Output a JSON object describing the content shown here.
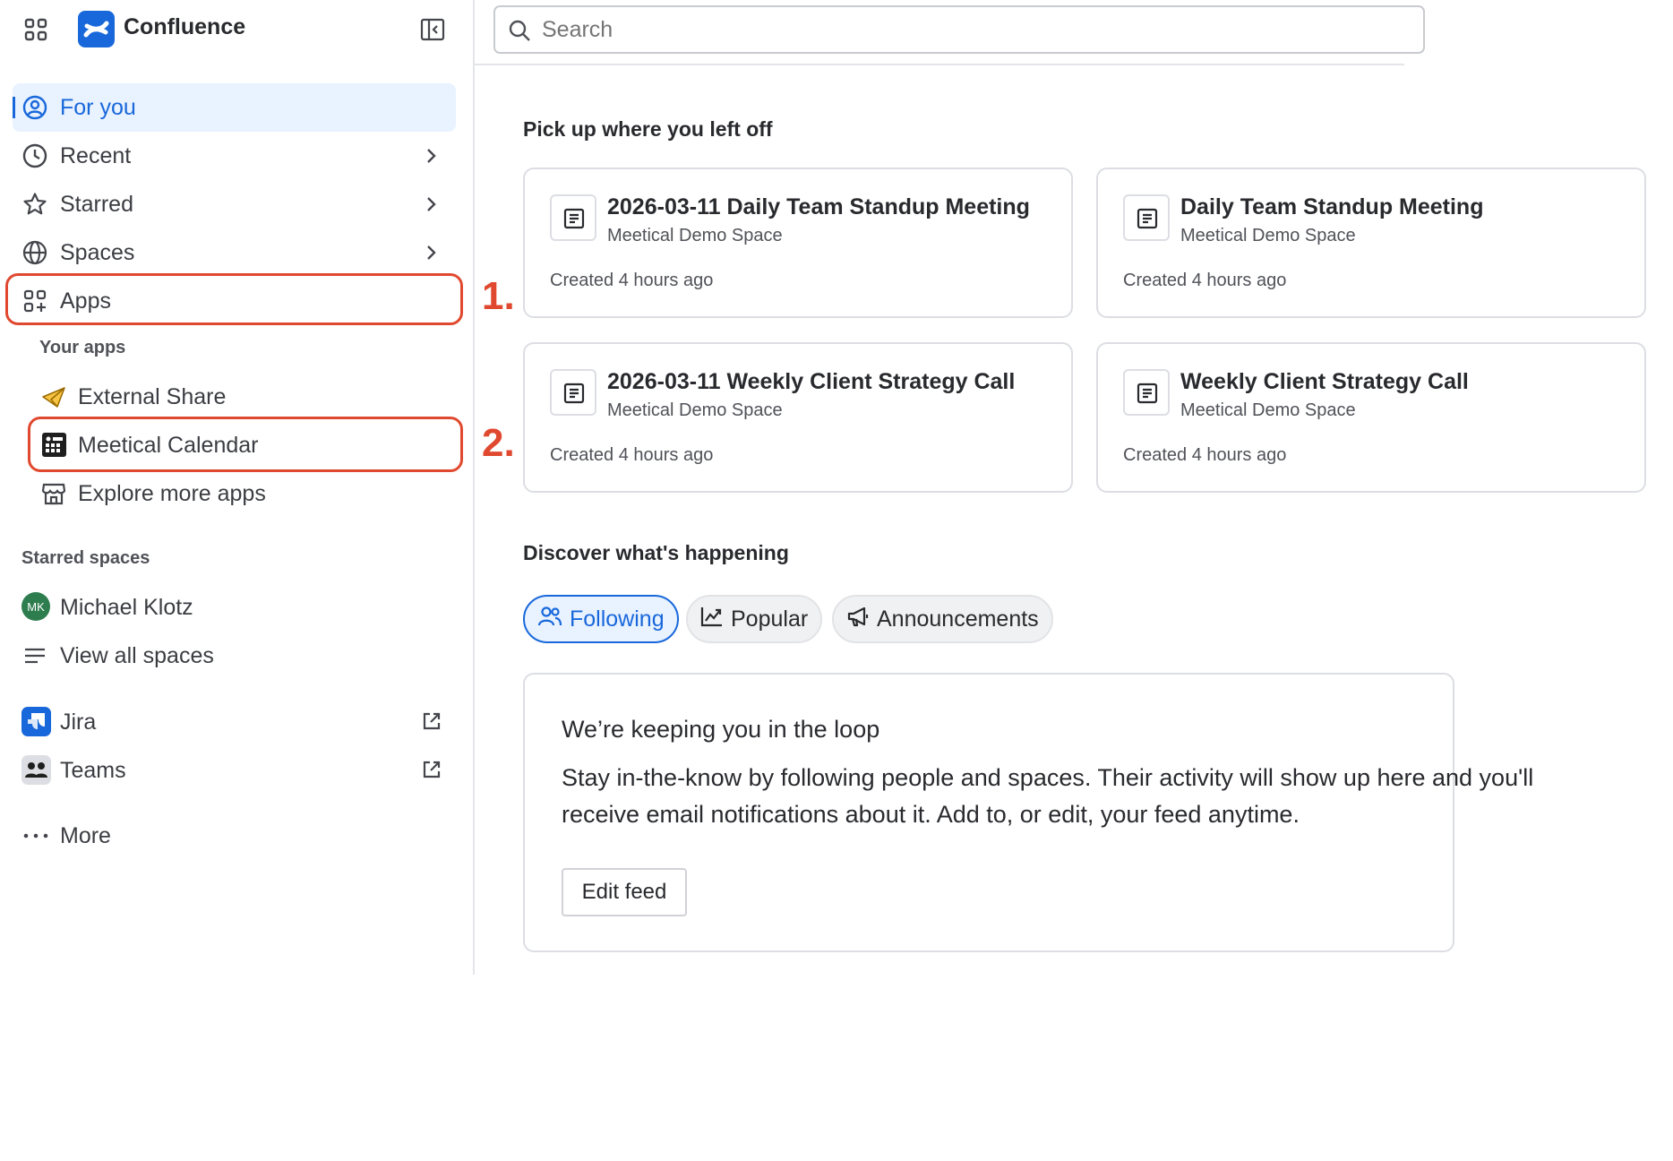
{
  "app": {
    "name": "Confluence",
    "brand_color": "#1868db"
  },
  "sidebar": {
    "nav": [
      {
        "label": "For you",
        "icon": "user-circle-icon",
        "active": true
      },
      {
        "label": "Recent",
        "icon": "clock-icon"
      },
      {
        "label": "Starred",
        "icon": "star-icon"
      },
      {
        "label": "Spaces",
        "icon": "globe-icon"
      },
      {
        "label": "Apps",
        "icon": "apps-icon"
      }
    ],
    "your_apps_heading": "Your apps",
    "apps": [
      {
        "label": "External Share",
        "icon": "paper-plane-icon"
      },
      {
        "label": "Meetical Calendar",
        "icon": "calendar-app-icon"
      },
      {
        "label": "Explore more apps",
        "icon": "store-icon"
      }
    ],
    "starred_spaces_heading": "Starred spaces",
    "starred_spaces": [
      {
        "label": "Michael Klotz",
        "avatar_initials": "MK",
        "avatar_color": "#2e7d4f"
      }
    ],
    "view_all_spaces": "View all spaces",
    "external": [
      {
        "label": "Jira",
        "icon": "jira-icon"
      },
      {
        "label": "Teams",
        "icon": "teams-icon"
      }
    ],
    "more": "More"
  },
  "search": {
    "placeholder": "Search"
  },
  "main": {
    "pickup_title": "Pick up where you left off",
    "cards": [
      {
        "title": "2026-03-11 Daily Team Standup Meeting",
        "space": "Meetical Demo Space",
        "time": "Created 4 hours ago"
      },
      {
        "title": "Daily Team Standup Meeting",
        "space": "Meetical Demo Space",
        "time": "Created 4 hours ago"
      },
      {
        "title": "2026-03-11 Weekly Client Strategy Call",
        "space": "Meetical Demo Space",
        "time": "Created 4 hours ago"
      },
      {
        "title": "Weekly Client Strategy Call",
        "space": "Meetical Demo Space",
        "time": "Created 4 hours ago"
      }
    ],
    "discover_title": "Discover what's happening",
    "tabs": [
      {
        "label": "Following",
        "icon": "people-icon",
        "active": true
      },
      {
        "label": "Popular",
        "icon": "trend-icon"
      },
      {
        "label": "Announcements",
        "icon": "megaphone-icon"
      }
    ],
    "feed": {
      "heading": "We’re keeping you in the loop",
      "body_line1": "Stay in-the-know by following people and spaces. Their activity will show up here and you'll",
      "body_line2": "receive email notifications about it. Add to, or edit, your feed anytime.",
      "button": "Edit feed"
    }
  },
  "annotations": {
    "step1": "1.",
    "step2": "2.",
    "color": "#e0492f"
  }
}
